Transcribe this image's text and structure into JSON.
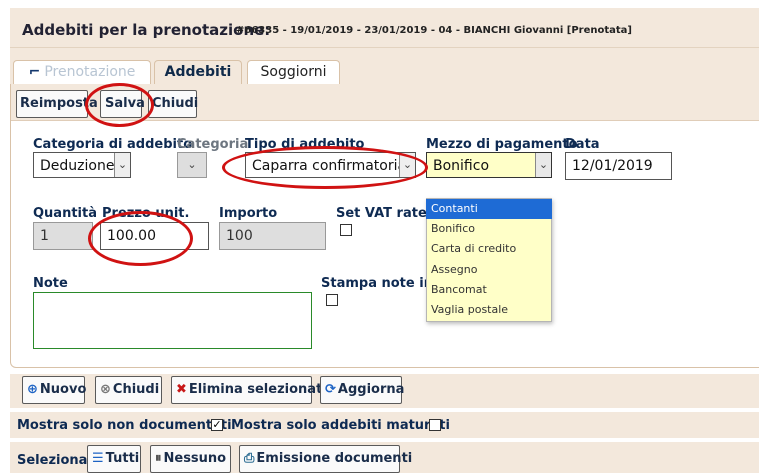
{
  "header": {
    "title": "Addebiti per la prenotazione:",
    "subtitle": "#66335 - 19/01/2019 - 23/01/2019 - 04 - BIANCHI Giovanni [Prenotata]"
  },
  "tabs": [
    {
      "label": "Prenotazione"
    },
    {
      "label": "Addebiti"
    },
    {
      "label": "Soggiorni"
    }
  ],
  "toolbar": {
    "reimposta": "Reimposta",
    "salva": "Salva",
    "chiudi": "Chiudi"
  },
  "form": {
    "categoria_addebito": {
      "label": "Categoria di addebito",
      "value": "Deduzione"
    },
    "categoria": {
      "label": "Categoria",
      "value": ""
    },
    "tipo_addebito": {
      "label": "Tipo di addebito",
      "value": "Caparra confirmatoria"
    },
    "mezzo_pagamento": {
      "label": "Mezzo di pagamento",
      "value": "Bonifico"
    },
    "data": {
      "label": "Data",
      "value": "12/01/2019"
    },
    "quantita": {
      "label": "Quantità",
      "value": "1"
    },
    "prezzo_unit": {
      "label": "Prezzo unit.",
      "value": "100.00"
    },
    "importo": {
      "label": "Importo",
      "value": "100"
    },
    "set_vat_rate": {
      "label": "Set VAT rate"
    },
    "note": {
      "label": "Note",
      "value": ""
    },
    "stampa_note": {
      "label": "Stampa note in fattura"
    }
  },
  "payment_options": [
    "Contanti",
    "Bonifico",
    "Carta di credito",
    "Assegno",
    "Bancomat",
    "Vaglia postale"
  ],
  "payment_selected_index": 0,
  "actions": {
    "nuovo": "Nuovo",
    "chiudi": "Chiudi",
    "elimina": "Elimina selezionati",
    "aggiorna": "Aggiorna"
  },
  "filters": {
    "solo_non_documentati": "Mostra solo non documentati",
    "solo_non_documentati_checked": true,
    "solo_maturati": "Mostra solo addebiti maturati",
    "solo_maturati_checked": false
  },
  "selection": {
    "label": "Seleziona",
    "tutti": "Tutti",
    "nessuno": "Nessuno",
    "emissione": "Emissione documenti"
  },
  "colors": {
    "header_bg": "#f3e8dc",
    "annotation": "#d01212",
    "dropdown_bg": "#ffffc8",
    "dropdown_selected": "#1e6bd5"
  }
}
